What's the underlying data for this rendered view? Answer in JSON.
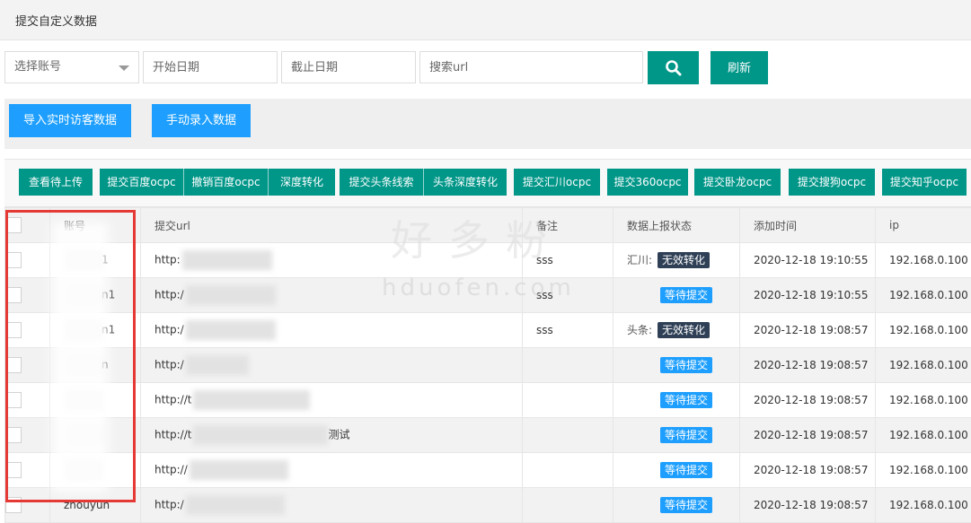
{
  "header": {
    "title": "提交自定义数据"
  },
  "filters": {
    "account_placeholder": "选择账号",
    "start_date_placeholder": "开始日期",
    "end_date_placeholder": "截止日期",
    "search_placeholder": "搜索url",
    "refresh_label": "刷新"
  },
  "actions": {
    "import_label": "导入实时访客数据",
    "manual_label": "手动录入数据"
  },
  "toolbar": [
    "查看待上传",
    "提交百度ocpc",
    "撤销百度ocpc",
    "深度转化",
    "提交头条线索",
    "头条深度转化",
    "提交汇川ocpc",
    "提交360ocpc",
    "提交卧龙ocpc",
    "提交搜狗ocpc",
    "提交知乎ocpc"
  ],
  "table": {
    "columns": [
      "账号",
      "提交url",
      "备注",
      "数据上报状态",
      "添加时间",
      "ip"
    ],
    "rows": [
      {
        "account": "1",
        "url": "http:",
        "note": "sss",
        "status_prefix": "汇川:",
        "status": "无效转化",
        "status_style": "dark",
        "time": "2020-12-18 19:10:55",
        "ip": "192.168.0.100"
      },
      {
        "account": "n1",
        "url": "http:/",
        "note": "sss",
        "status_prefix": "",
        "status": "等待提交",
        "status_style": "blue",
        "time": "2020-12-18 19:10:55",
        "ip": "192.168.0.100"
      },
      {
        "account": "n1",
        "url": "http:/",
        "note": "sss",
        "status_prefix": "头条:",
        "status": "无效转化",
        "status_style": "dark",
        "time": "2020-12-18 19:08:57",
        "ip": "192.168.0.100"
      },
      {
        "account": "n",
        "url": "http:/",
        "note": "",
        "status_prefix": "",
        "status": "等待提交",
        "status_style": "blue",
        "time": "2020-12-18 19:08:57",
        "ip": "192.168.0.100"
      },
      {
        "account": "",
        "url": "http://t",
        "note": "",
        "status_prefix": "",
        "status": "等待提交",
        "status_style": "blue",
        "time": "2020-12-18 19:08:57",
        "ip": "192.168.0.100"
      },
      {
        "account": "",
        "url": "http://t",
        "url_suffix": "测试",
        "note": "",
        "status_prefix": "",
        "status": "等待提交",
        "status_style": "blue",
        "time": "2020-12-18 19:08:57",
        "ip": "192.168.0.100"
      },
      {
        "account": "",
        "url": "http://",
        "note": "",
        "status_prefix": "",
        "status": "等待提交",
        "status_style": "blue",
        "time": "2020-12-18 19:08:57",
        "ip": "192.168.0.100"
      },
      {
        "account": "zhouyun",
        "url": "http:/",
        "note": "",
        "status_prefix": "",
        "status": "等待提交",
        "status_style": "blue",
        "time": "2020-12-18 19:08:57",
        "ip": "192.168.0.100"
      }
    ]
  },
  "watermark": {
    "text": "好多粉",
    "domain": "hduofen.com"
  },
  "colors": {
    "teal": "#009688",
    "blue": "#1e9fff",
    "dark": "#2f4056",
    "highlight": "#e53935"
  }
}
